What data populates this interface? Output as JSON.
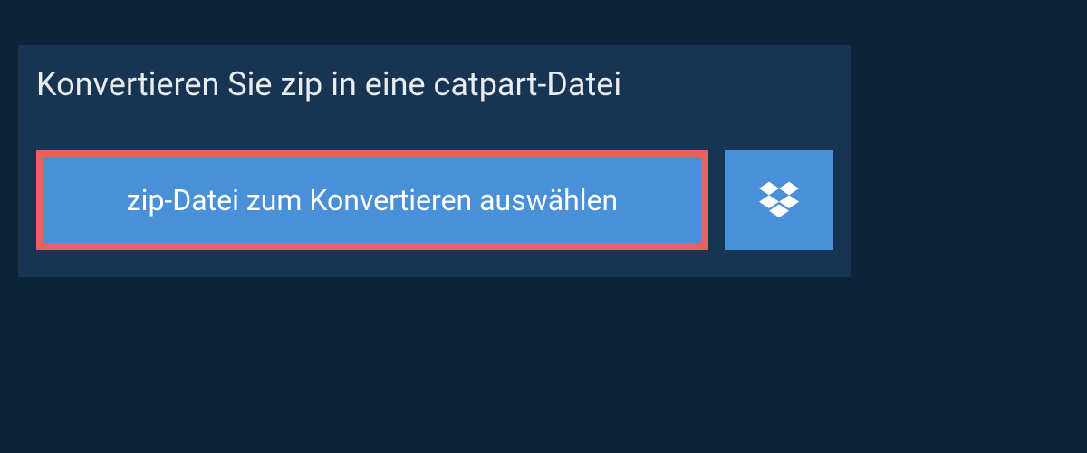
{
  "header": {
    "title": "Konvertieren Sie zip in eine catpart-Datei"
  },
  "actions": {
    "select_file_label": "zip-Datei zum Konvertieren auswählen",
    "dropbox_icon": "dropbox-icon"
  },
  "colors": {
    "page_bg": "#0d2438",
    "panel_bg": "#173552",
    "button_bg": "#4a90d9",
    "button_border_highlight": "#e86060",
    "text_light": "#ffffff"
  }
}
